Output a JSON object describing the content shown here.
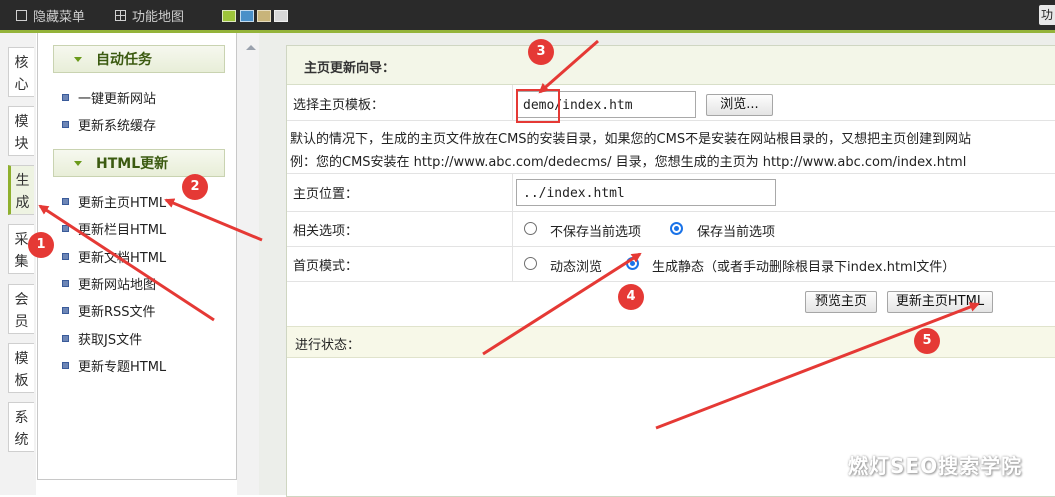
{
  "topbar": {
    "hide_menu_label": "隐藏菜单",
    "site_map_label": "功能地图",
    "right_button_label": "功",
    "swatches": [
      "#9dc43a",
      "#4a90c8",
      "#c8b47a",
      "#d8d8d8"
    ]
  },
  "left_tabs": [
    {
      "label": "核心"
    },
    {
      "label": "模块"
    },
    {
      "label": "生成",
      "active": true
    },
    {
      "label": "采集"
    },
    {
      "label": "会员"
    },
    {
      "label": "模板"
    },
    {
      "label": "系统"
    }
  ],
  "submenu": {
    "section1_title": "自动任务",
    "section1_items": [
      "一键更新网站",
      "更新系统缓存"
    ],
    "section2_title": "HTML更新",
    "section2_items": [
      "更新主页HTML",
      "更新栏目HTML",
      "更新文档HTML",
      "更新网站地图",
      "更新RSS文件",
      "获取JS文件",
      "更新专题HTML"
    ]
  },
  "panel": {
    "title": "主页更新向导：",
    "template_label": "选择主页模板：",
    "template_value": "demo/index.htm",
    "browse_button": "浏览...",
    "note_line1": "默认的情况下，生成的主页文件放在CMS的安装目录，如果您的CMS不是安装在网站根目录的，又想把主页创建到网站",
    "note_line2": "例：您的CMS安装在 http://www.abc.com/dedecms/ 目录，您想生成的主页为 http://www.abc.com/index.html",
    "position_label": "主页位置：",
    "position_value": "../index.html",
    "options_label": "相关选项：",
    "option_no_save": "不保存当前选项",
    "option_save": "保存当前选项",
    "option_selected": "save",
    "mode_label": "首页模式：",
    "mode_dynamic": "动态浏览",
    "mode_static": "生成静态（或者手动删除根目录下index.html文件）",
    "mode_selected": "static",
    "preview_button": "预览主页",
    "update_button": "更新主页HTML",
    "status_label": "进行状态："
  },
  "annotations": {
    "badge1": "1",
    "badge2": "2",
    "badge3": "3",
    "badge4": "4",
    "badge5": "5",
    "color": "#e53935"
  },
  "watermark": "燃灯SEO搜索学院"
}
